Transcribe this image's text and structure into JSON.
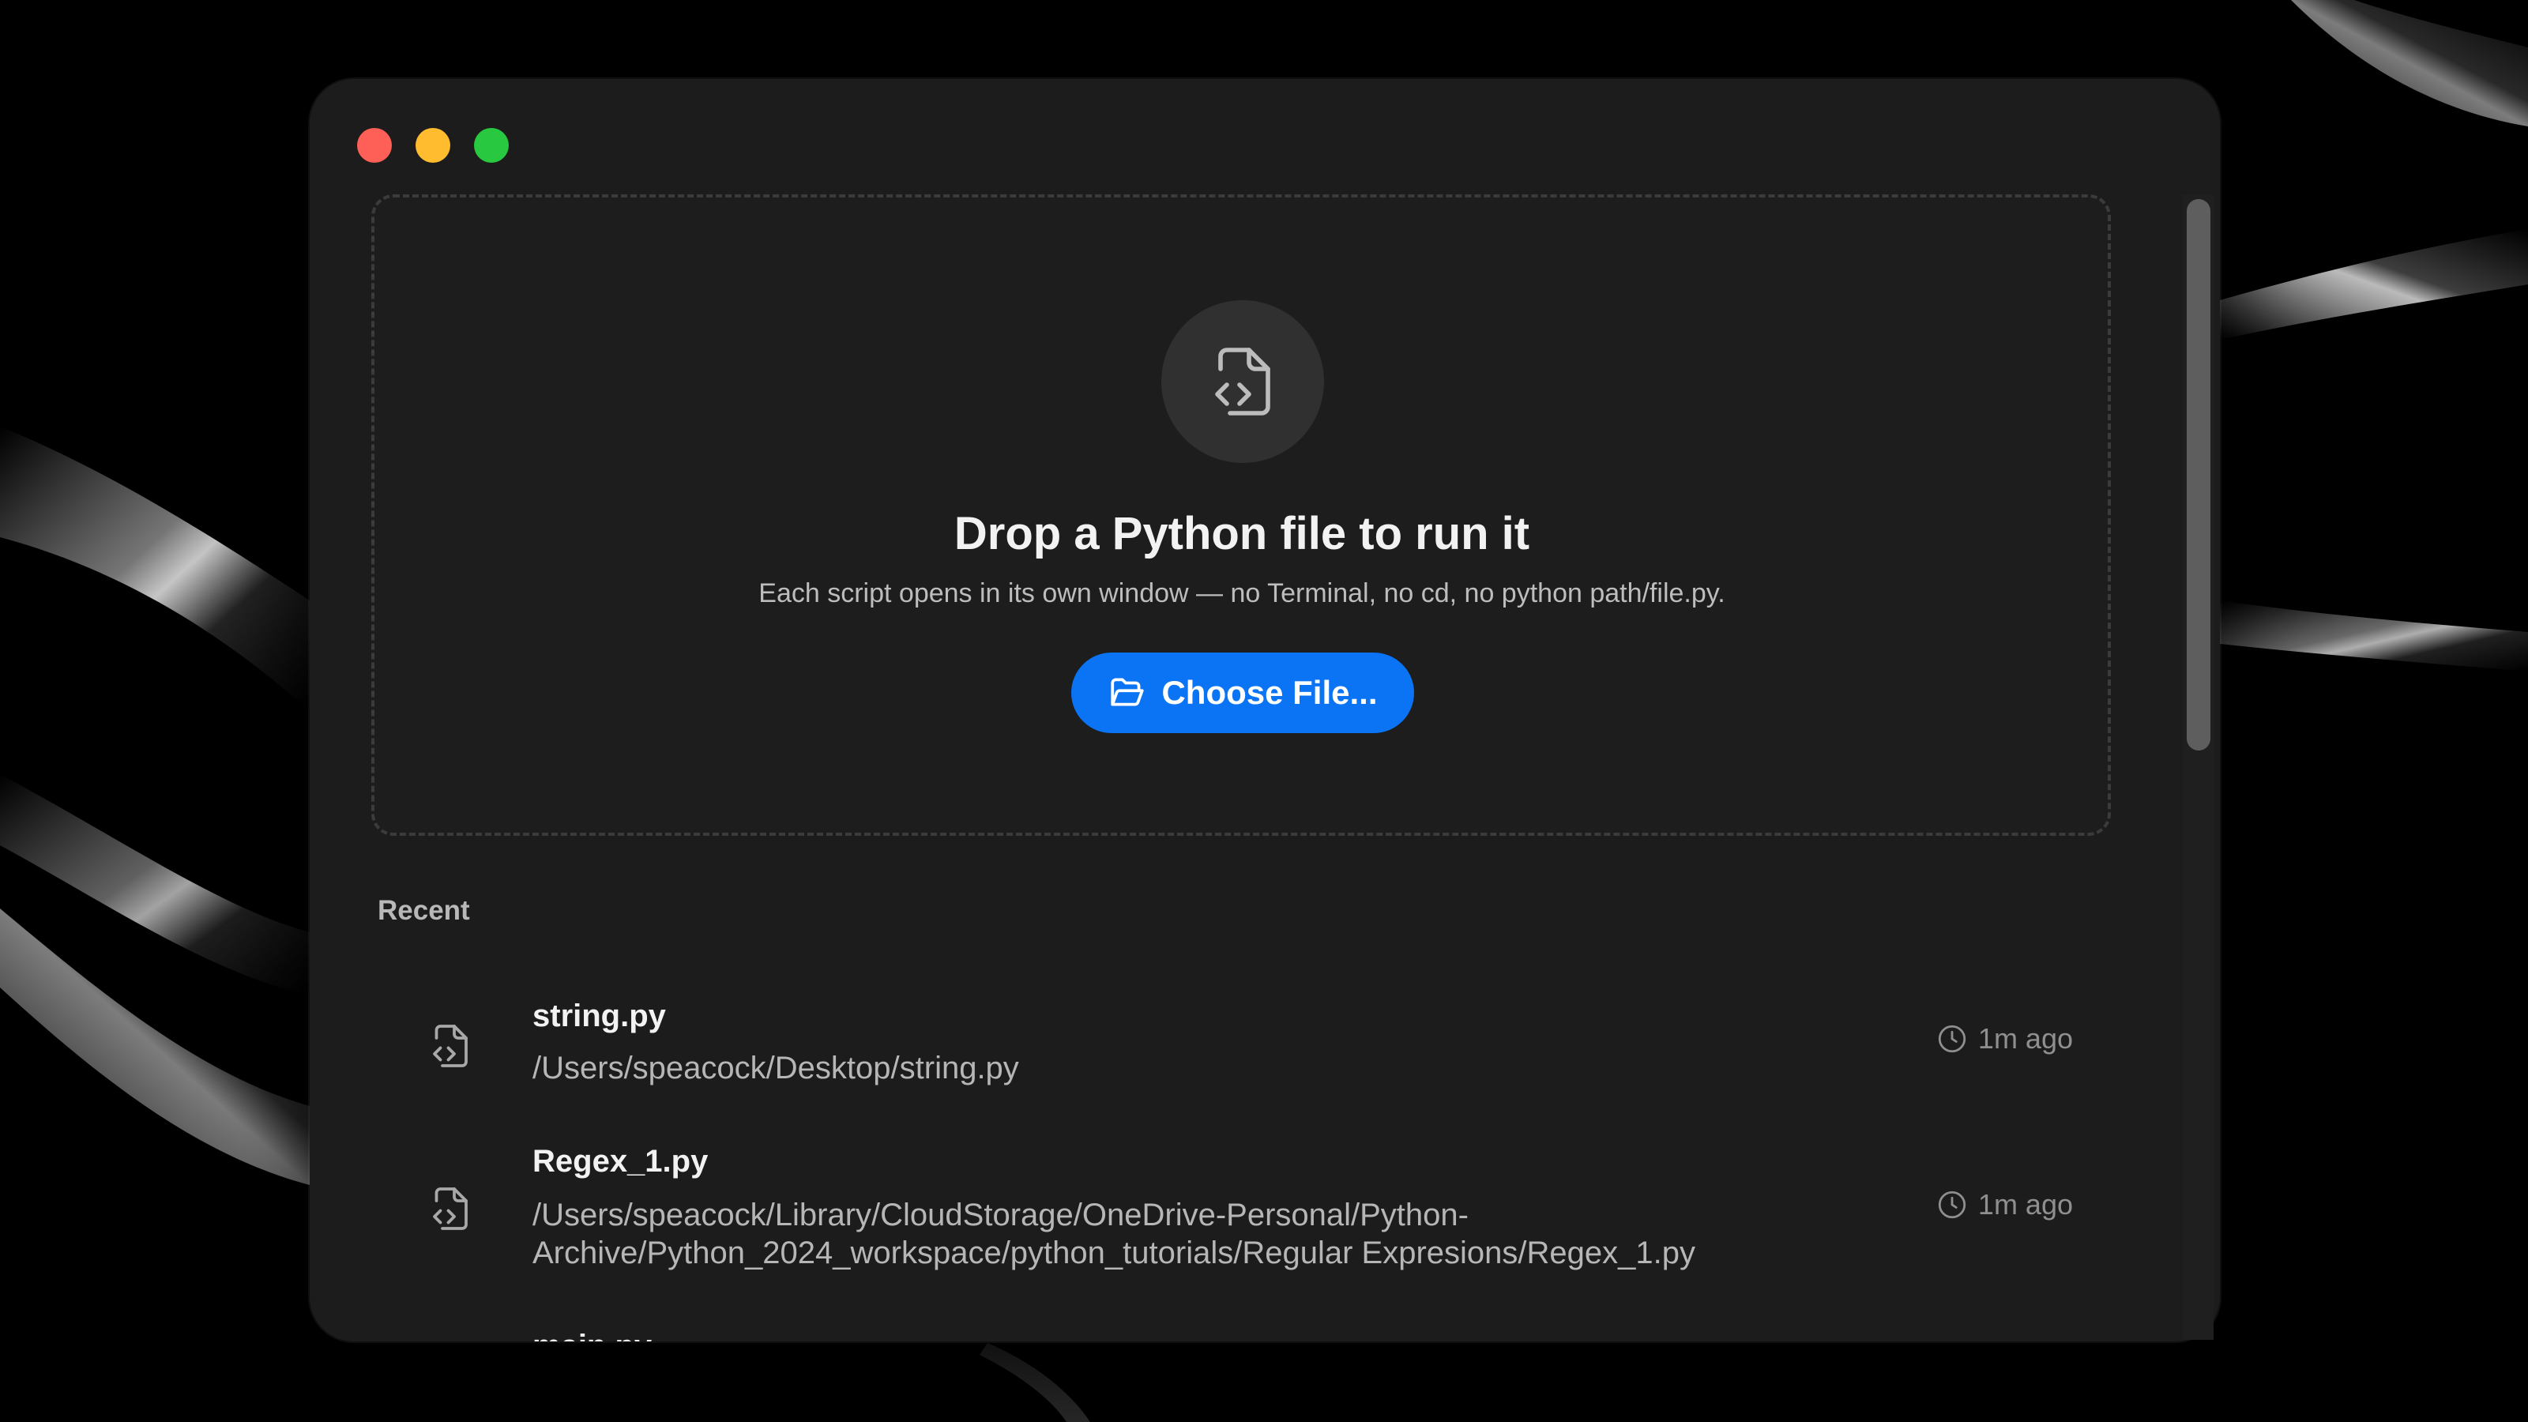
{
  "window": {
    "controls": [
      "close",
      "minimize",
      "zoom"
    ]
  },
  "dropzone": {
    "title": "Drop a Python file to run it",
    "subtitle": "Each script opens in its own window — no Terminal, no cd, no python path/file.py.",
    "icon": "code-file-icon",
    "button_label": "Choose File...",
    "button_icon": "folder-open-icon"
  },
  "recent": {
    "heading": "Recent",
    "items": [
      {
        "name": "string.py",
        "path": "/Users/speacock/Desktop/string.py",
        "time": "1m ago",
        "icon": "code-file-icon"
      },
      {
        "name": "Regex_1.py",
        "path": "/Users/speacock/Library/CloudStorage/OneDrive-Personal/Python-Archive/Python_2024_workspace/python_tutorials/Regular Expresions/Regex_1.py",
        "time": "1m ago",
        "icon": "code-file-icon"
      },
      {
        "name": "main.py",
        "icon": "code-file-icon"
      }
    ]
  },
  "colors": {
    "accent": "#0a74f5",
    "window_bg": "#1c1c1c",
    "close": "#fe5f57",
    "minimize": "#febc2e",
    "zoom": "#28c840"
  }
}
